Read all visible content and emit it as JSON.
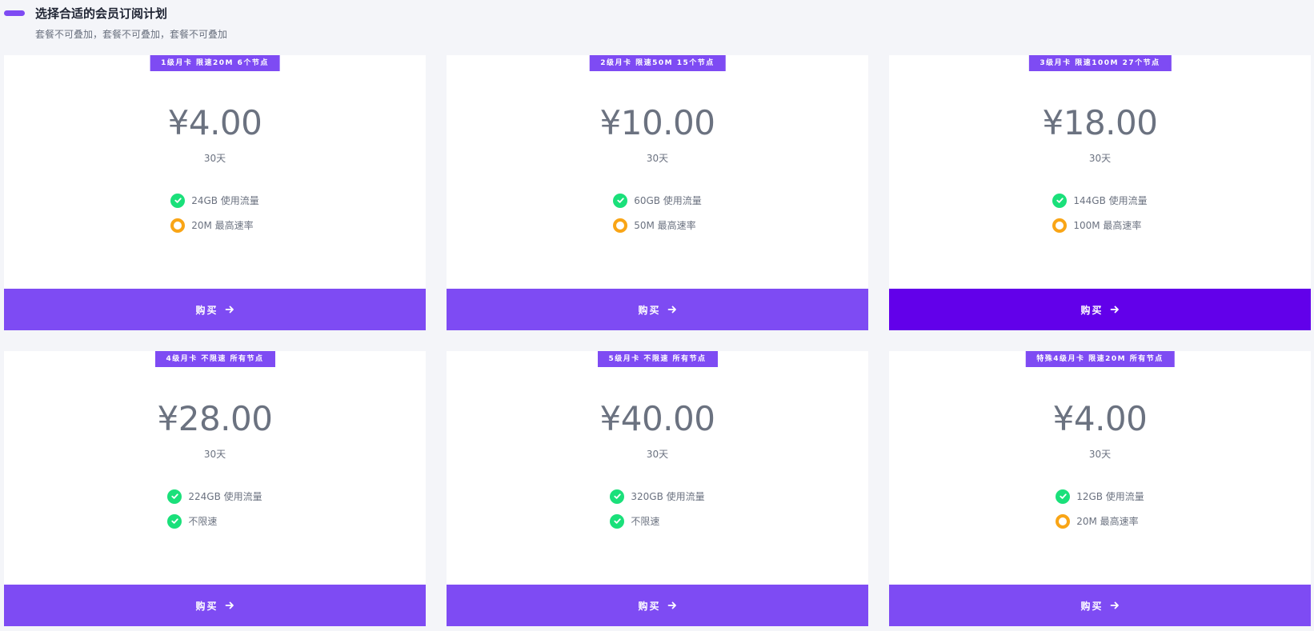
{
  "header": {
    "title": "选择合适的会员订阅计划",
    "subtitle": "套餐不可叠加，套餐不可叠加，套餐不可叠加"
  },
  "plans": [
    {
      "tag": "1级月卡 限速20M 6个节点",
      "price": "¥4.00",
      "period": "30天",
      "features": [
        {
          "text": "24GB 使用流量",
          "icon": "check-circle-icon"
        },
        {
          "text": "20M 最高速率",
          "icon": "ring-icon"
        }
      ],
      "buy_label": "购买"
    },
    {
      "tag": "2级月卡 限速50M 15个节点",
      "price": "¥10.00",
      "period": "30天",
      "features": [
        {
          "text": "60GB 使用流量",
          "icon": "check-circle-icon"
        },
        {
          "text": "50M 最高速率",
          "icon": "ring-icon"
        }
      ],
      "buy_label": "购买"
    },
    {
      "tag": "3级月卡 限速100M 27个节点",
      "price": "¥18.00",
      "period": "30天",
      "features": [
        {
          "text": "144GB 使用流量",
          "icon": "check-circle-icon"
        },
        {
          "text": "100M 最高速率",
          "icon": "ring-icon"
        }
      ],
      "buy_label": "购买"
    },
    {
      "tag": "4级月卡 不限速 所有节点",
      "price": "¥28.00",
      "period": "30天",
      "features": [
        {
          "text": "224GB 使用流量",
          "icon": "check-circle-icon"
        },
        {
          "text": "不限速",
          "icon": "check-circle-icon"
        }
      ],
      "buy_label": "购买"
    },
    {
      "tag": "5级月卡 不限速 所有节点",
      "price": "¥40.00",
      "period": "30天",
      "features": [
        {
          "text": "320GB 使用流量",
          "icon": "check-circle-icon"
        },
        {
          "text": "不限速",
          "icon": "check-circle-icon"
        }
      ],
      "buy_label": "购买"
    },
    {
      "tag": "特殊4级月卡 限速20M 所有节点",
      "price": "¥4.00",
      "period": "30天",
      "features": [
        {
          "text": "12GB 使用流量",
          "icon": "check-circle-icon"
        },
        {
          "text": "20M 最高速率",
          "icon": "ring-icon"
        }
      ],
      "buy_label": "购买"
    }
  ],
  "colors": {
    "accent": "#7e4bf3",
    "accent_active": "#6200ea",
    "check_green": "#1ae07a",
    "ring_orange": "#f9a516",
    "text_muted": "#6b7280",
    "background": "#f4f5f9"
  }
}
